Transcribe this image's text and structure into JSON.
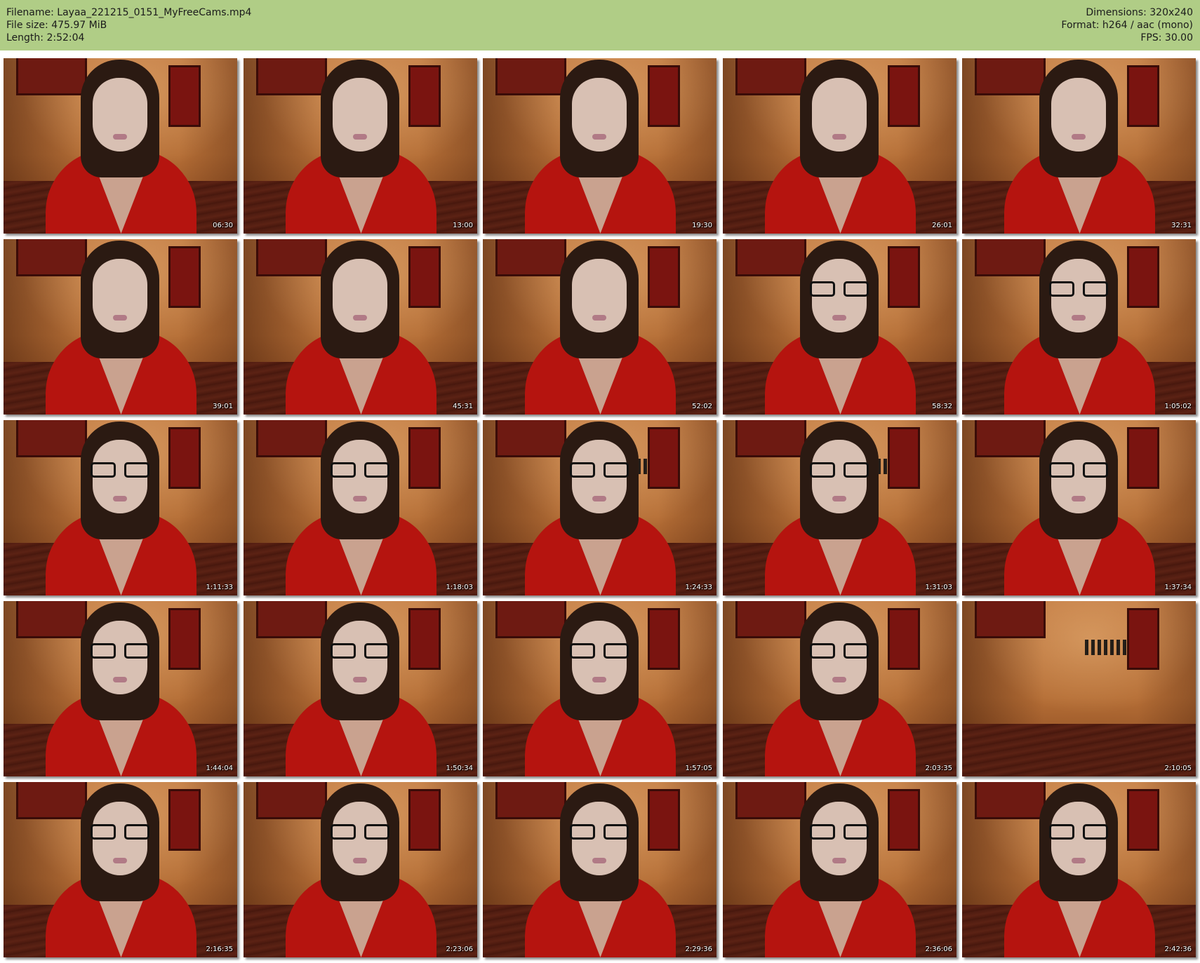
{
  "header": {
    "filename_line": "Filename: Layaa_221215_0151_MyFreeCams.mp4",
    "filesize_line": "File size: 475.97 MiB",
    "length_line": "Length: 2:52:04",
    "dimensions_line": "Dimensions: 320x240",
    "format_line": "Format: h264 / aac (mono)",
    "fps_line": "FPS: 30.00",
    "background_color": "#b0cd86"
  },
  "thumbnails": [
    {
      "timestamp": "06:30",
      "glasses": false,
      "person": true,
      "decal": false
    },
    {
      "timestamp": "13:00",
      "glasses": false,
      "person": true,
      "decal": false
    },
    {
      "timestamp": "19:30",
      "glasses": false,
      "person": true,
      "decal": false
    },
    {
      "timestamp": "26:01",
      "glasses": false,
      "person": true,
      "decal": false
    },
    {
      "timestamp": "32:31",
      "glasses": false,
      "person": true,
      "decal": false
    },
    {
      "timestamp": "39:01",
      "glasses": false,
      "person": true,
      "decal": false
    },
    {
      "timestamp": "45:31",
      "glasses": false,
      "person": true,
      "decal": false
    },
    {
      "timestamp": "52:02",
      "glasses": false,
      "person": true,
      "decal": false
    },
    {
      "timestamp": "58:32",
      "glasses": true,
      "person": true,
      "decal": false
    },
    {
      "timestamp": "1:05:02",
      "glasses": true,
      "person": true,
      "decal": false
    },
    {
      "timestamp": "1:11:33",
      "glasses": true,
      "person": true,
      "decal": false
    },
    {
      "timestamp": "1:18:03",
      "glasses": true,
      "person": true,
      "decal": false
    },
    {
      "timestamp": "1:24:33",
      "glasses": true,
      "person": true,
      "decal": true
    },
    {
      "timestamp": "1:31:03",
      "glasses": true,
      "person": true,
      "decal": true
    },
    {
      "timestamp": "1:37:34",
      "glasses": true,
      "person": true,
      "decal": false
    },
    {
      "timestamp": "1:44:04",
      "glasses": true,
      "person": true,
      "decal": false
    },
    {
      "timestamp": "1:50:34",
      "glasses": true,
      "person": true,
      "decal": false
    },
    {
      "timestamp": "1:57:05",
      "glasses": true,
      "person": true,
      "decal": false
    },
    {
      "timestamp": "2:03:35",
      "glasses": true,
      "person": true,
      "decal": false
    },
    {
      "timestamp": "2:10:05",
      "glasses": false,
      "person": false,
      "decal": true
    },
    {
      "timestamp": "2:16:35",
      "glasses": true,
      "person": true,
      "decal": false
    },
    {
      "timestamp": "2:23:06",
      "glasses": true,
      "person": true,
      "decal": false
    },
    {
      "timestamp": "2:29:36",
      "glasses": true,
      "person": true,
      "decal": false
    },
    {
      "timestamp": "2:36:06",
      "glasses": true,
      "person": true,
      "decal": false
    },
    {
      "timestamp": "2:42:36",
      "glasses": true,
      "person": true,
      "decal": false
    }
  ]
}
